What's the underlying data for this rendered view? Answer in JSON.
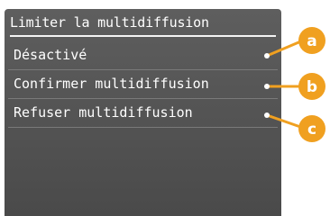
{
  "screen": {
    "title": "Limiter la multidiffusion",
    "items": [
      {
        "label": "Désactivé"
      },
      {
        "label": "Confirmer multidiffusion"
      },
      {
        "label": "Refuser multidiffusion"
      }
    ]
  },
  "callouts": [
    {
      "letter": "a"
    },
    {
      "letter": "b"
    },
    {
      "letter": "c"
    }
  ],
  "colors": {
    "screen_bg": "#555555",
    "callout": "#f0a020",
    "text": "#ffffff"
  }
}
